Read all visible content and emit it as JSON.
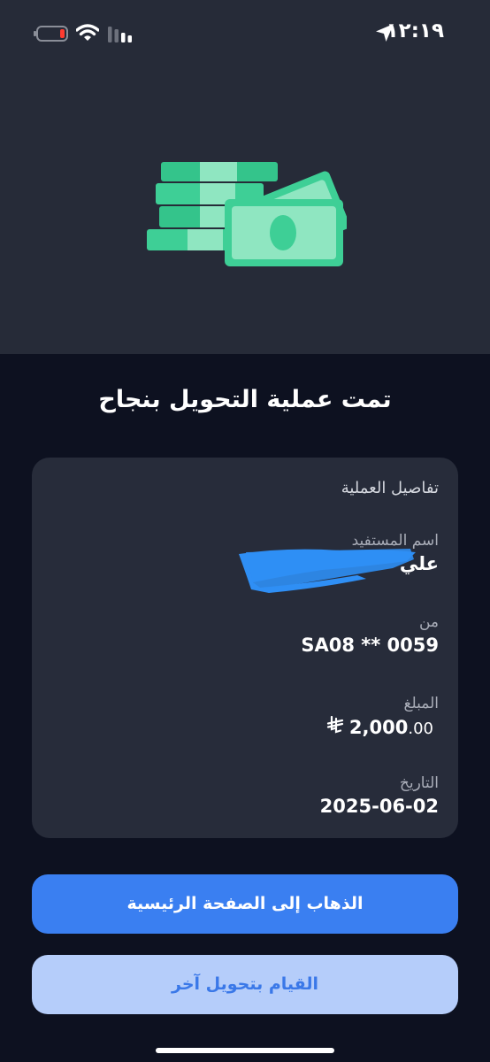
{
  "status_bar": {
    "time": "١٢:١٩",
    "icons": [
      "location-arrow-icon",
      "battery-low-icon",
      "wifi-icon",
      "cellular-signal-icon"
    ]
  },
  "illustration": "money-stack-icon",
  "title": "تمت عملية التحويل بنجاح",
  "details": {
    "heading": "تفاصيل العملية",
    "beneficiary": {
      "label": "اسم المستفيد",
      "value": "علي"
    },
    "from": {
      "label": "من",
      "value": "SA08 ** 0059"
    },
    "amount": {
      "label": "المبلغ",
      "value_whole": "2,000",
      "value_decimal": ".00",
      "currency_icon": "saudi-riyal-icon"
    },
    "date": {
      "label": "التاريخ",
      "value": "2025-06-02"
    }
  },
  "buttons": {
    "home": "الذهاب إلى الصفحة الرئيسية",
    "new_transfer": "القيام بتحويل آخر"
  },
  "colors": {
    "hero_bg": "#262b38",
    "page_bg": "#0d1120",
    "card_bg": "#272c3a",
    "primary": "#3a7ff1",
    "secondary_bg": "#b5cdfa",
    "money_green": "#3ecf96",
    "redaction_blue": "#2f8ff5"
  }
}
